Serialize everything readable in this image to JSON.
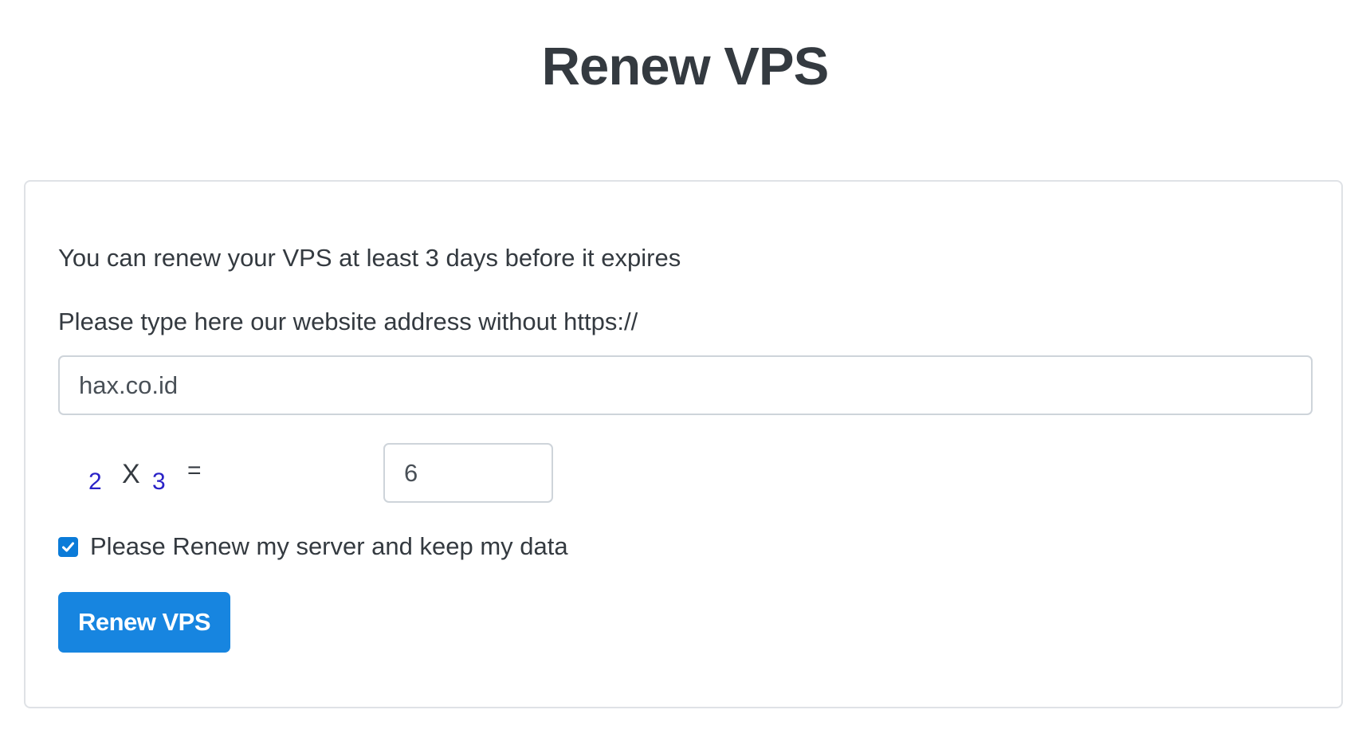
{
  "page": {
    "title": "Renew VPS"
  },
  "form": {
    "notice": "You can renew your VPS at least 3 days before it expires",
    "website_label": "Please type here our website address without https://",
    "website_value": "hax.co.id",
    "captcha": {
      "operand_a": "2",
      "operator": "X",
      "operand_b": "3",
      "equals": "="
    },
    "captcha_answer": "6",
    "agree_label": "Please Renew my server and keep my data",
    "agree_checked": true,
    "submit_label": "Renew VPS"
  },
  "colors": {
    "accent": "#1785e0",
    "checkbox": "#0b7bd8",
    "captcha_digits": "#2a22c7",
    "text": "#343a40",
    "border": "#ced4da"
  },
  "icons": {
    "checkbox": "check-icon"
  }
}
